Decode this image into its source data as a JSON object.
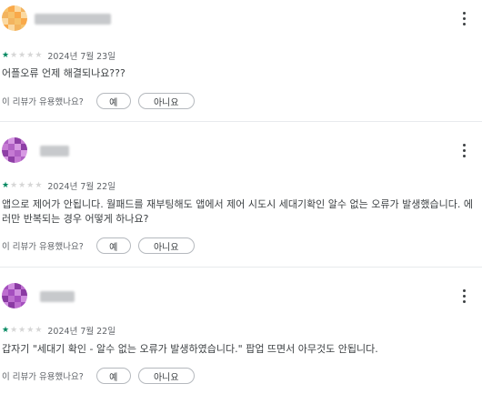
{
  "reviews": [
    {
      "rating": 1,
      "date": "2024년 7월 23일",
      "text": "어플오류 언제 해결되나요???",
      "avatar_colors": [
        "#f6c26b",
        "#f9a94a",
        "#fbd9a1",
        "#f3b45f"
      ],
      "name_blur_color": "#c7c9cc"
    },
    {
      "rating": 1,
      "date": "2024년 7월 22일",
      "text": "앱으로 제어가 안됩니다. 월패드를 재부팅해도 앱에서 제어 시도시 세대기확인 알수 없는 오류가 발생했습니다. 에러만 반복되는 경우 어떻게 하나요?",
      "avatar_colors": [
        "#b061c4",
        "#d79ae3",
        "#8e3fa6",
        "#c57ad3"
      ],
      "name_blur_color": "#c7c9cc"
    },
    {
      "rating": 1,
      "date": "2024년 7월 22일",
      "text": "갑자기 \"세대기 확인 - 알수 없는 오류가 발생하였습니다.\" 팝업 뜨면서 아무것도 안됩니다.",
      "avatar_colors": [
        "#a54fbf",
        "#cf8ddf",
        "#8a3aa3",
        "#bd6fcf"
      ],
      "name_blur_color": "#c7c9cc"
    }
  ],
  "helpful": {
    "question": "이 리뷰가 유용했나요?",
    "yes_label": "예",
    "no_label": "아니요"
  },
  "icons": {
    "more": "more-vert-icon",
    "star": "star-icon"
  },
  "colors": {
    "star_filled": "#01875f",
    "star_empty": "#d6d6d6"
  }
}
